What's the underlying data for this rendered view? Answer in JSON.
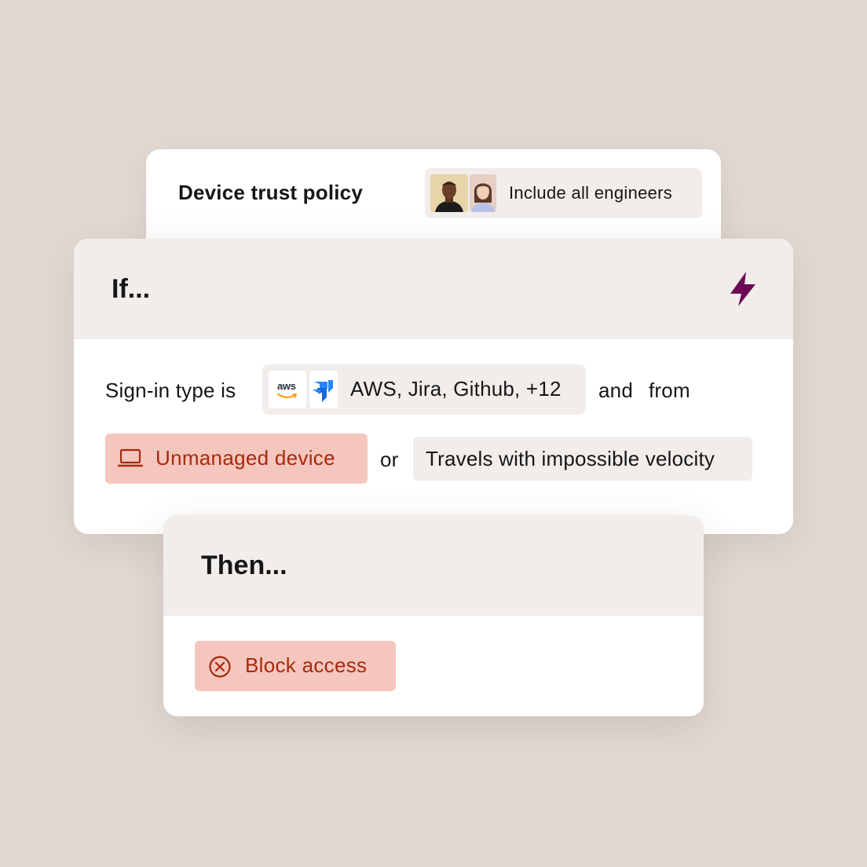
{
  "policy": {
    "title": "Device trust policy",
    "audience": {
      "label": "Include all engineers",
      "avatars": [
        "engineer-avatar-1",
        "engineer-avatar-2"
      ]
    }
  },
  "if_block": {
    "title": "If...",
    "icon": "lightning-bolt-icon",
    "sign_in_prefix": "Sign-in type is",
    "apps": {
      "logos": [
        "aws-logo",
        "jira-logo"
      ],
      "aws_wordmark": "aws",
      "label": "AWS, Jira, Github, +12"
    },
    "connector_and": "and",
    "connector_from": "from",
    "unmanaged": {
      "icon": "laptop-icon",
      "label": "Unmanaged device"
    },
    "connector_or": "or",
    "velocity": {
      "label": "Travels with impossible velocity"
    }
  },
  "then_block": {
    "title": "Then...",
    "action": {
      "icon": "x-circle-icon",
      "label": "Block access"
    }
  },
  "colors": {
    "background": "#e2d9d3",
    "card": "#ffffff",
    "chip": "#f1edea",
    "danger_chip": "#f5c6bd",
    "danger_text": "#a8290d",
    "accent_bolt": "#6e0a55",
    "jira_blue": "#2684ff"
  }
}
